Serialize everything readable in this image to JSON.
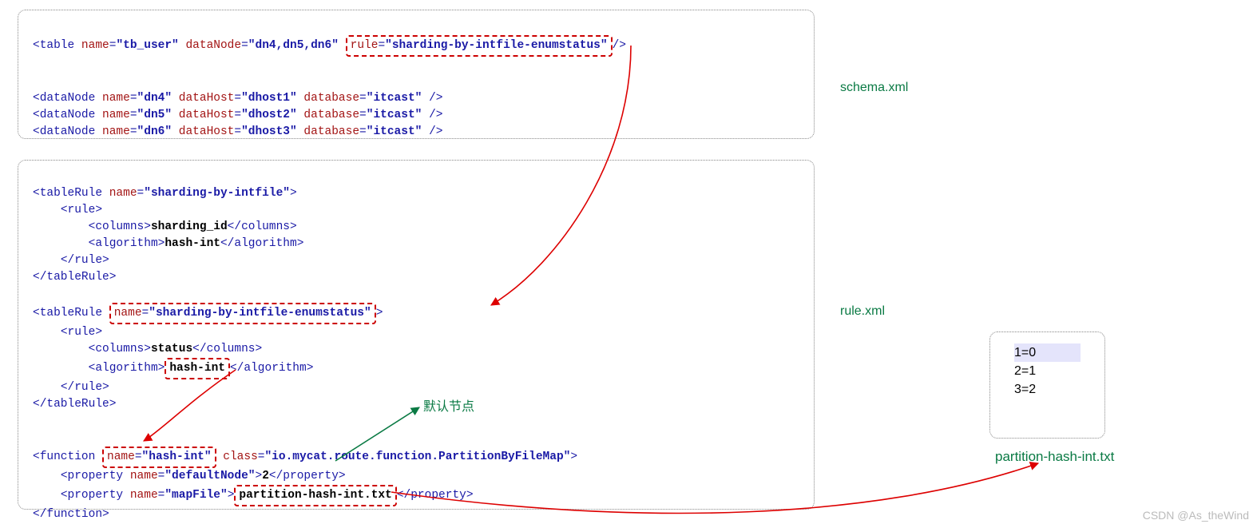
{
  "labels": {
    "schema": "schema.xml",
    "rule": "rule.xml",
    "file": "partition-hash-int.txt",
    "defaultNode": "默认节点",
    "watermark": "CSDN @As_theWind"
  },
  "schema": {
    "table_tag": "table",
    "table_name_attr": "name",
    "table_name_val": "\"tb_user\"",
    "dataNode_attr": "dataNode",
    "dataNode_val": "\"dn4,dn5,dn6\"",
    "rule_attr": "rule",
    "rule_val": "\"sharding-by-intfile-enumstatus\"",
    "dn_tag": "dataNode",
    "dn": [
      {
        "name": "\"dn4\"",
        "host": "\"dhost1\"",
        "db": "\"itcast\""
      },
      {
        "name": "\"dn5\"",
        "host": "\"dhost2\"",
        "db": "\"itcast\""
      },
      {
        "name": "\"dn6\"",
        "host": "\"dhost3\"",
        "db": "\"itcast\""
      }
    ],
    "dataHost_attr": "dataHost",
    "database_attr": "database"
  },
  "ruleblock": {
    "tableRule_tag": "tableRule",
    "name_attr": "name",
    "rule_tag": "rule",
    "columns_tag": "columns",
    "algorithm_tag": "algorithm",
    "tr1_name": "\"sharding-by-intfile\"",
    "tr1_col": "sharding_id",
    "tr1_alg": "hash-int",
    "tr2_name": "\"sharding-by-intfile-enumstatus\"",
    "tr2_col": "status",
    "tr2_alg": "hash-int",
    "func_tag": "function",
    "func_name": "\"hash-int\"",
    "class_attr": "class",
    "func_class": "\"io.mycat.route.function.PartitionByFileMap\"",
    "prop_tag": "property",
    "prop1_name": "\"defaultNode\"",
    "prop1_val": "2",
    "prop2_name": "\"mapFile\"",
    "prop2_val": "partition-hash-int.txt"
  },
  "mapfile": {
    "l1": "1=0",
    "l2": "2=1",
    "l3": "3=2"
  }
}
